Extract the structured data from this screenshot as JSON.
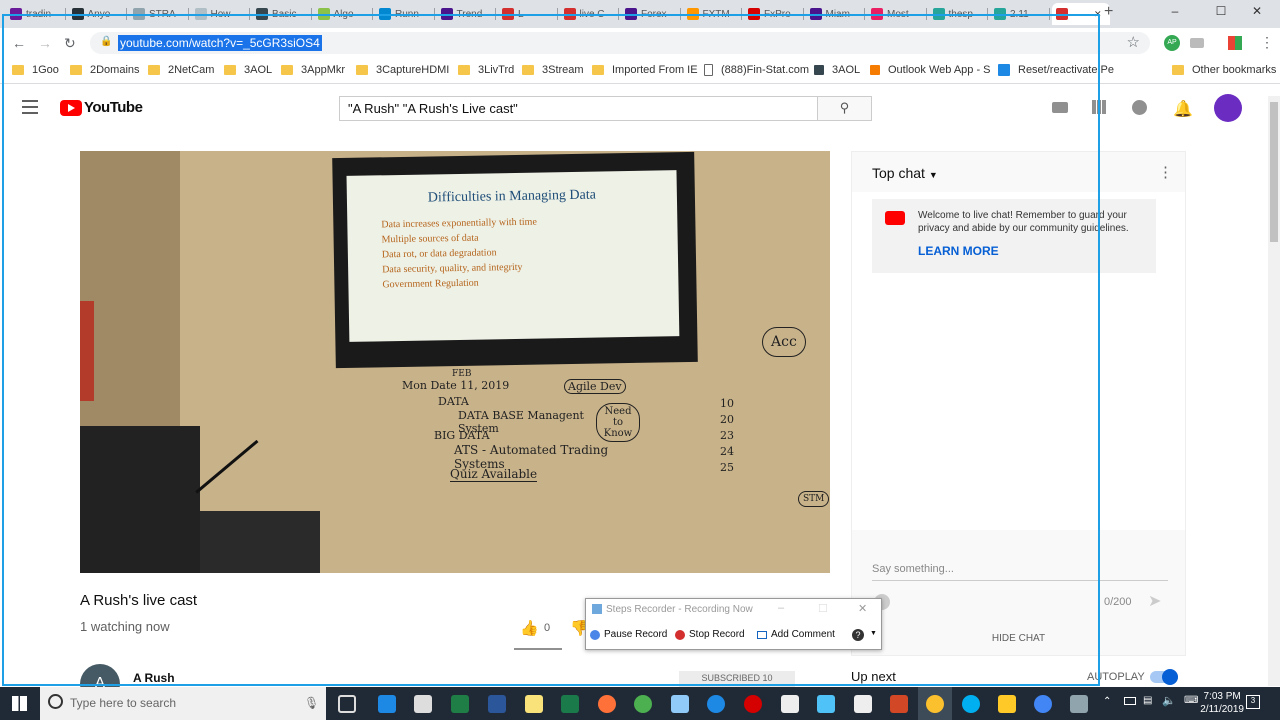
{
  "browser": {
    "tabs": [
      {
        "label": "tradin",
        "color": "#6a1b9a"
      },
      {
        "label": "Anyo",
        "color": "#263238"
      },
      {
        "label": "STRA",
        "color": "#90a4ae"
      },
      {
        "label": "How",
        "color": "#b0bec5"
      },
      {
        "label": "Basic",
        "color": "#37474f"
      },
      {
        "label": "Algo",
        "color": "#8bc34a"
      },
      {
        "label": "Runn",
        "color": "#0288d1"
      },
      {
        "label": "Trend",
        "color": "#4a148c"
      },
      {
        "label": "L",
        "color": "#d32f2f"
      },
      {
        "label": "live C",
        "color": "#d32f2f"
      },
      {
        "label": "Forex",
        "color": "#4a148c"
      },
      {
        "label": "FXTM",
        "color": "#ff9800"
      },
      {
        "label": "FxPro",
        "color": "#d50000"
      },
      {
        "label": "Miam",
        "color": "#4a148c"
      },
      {
        "label": "Most",
        "color": "#e91e63"
      },
      {
        "label": "thesp",
        "color": "#26a69a"
      },
      {
        "label": "2.11",
        "color": "#26a69a"
      },
      {
        "label": "",
        "color": "#d32f2f"
      }
    ],
    "new_tab": "+",
    "window_controls": [
      "–",
      "☐",
      "✕"
    ],
    "url": "youtube.com/watch?v=_5cGR3siOS4",
    "bookmarks": [
      "1Goo",
      "2Domains",
      "2NetCam",
      "3AOL",
      "3AppMkr",
      "3CaptureHDMI",
      "3LivTrd",
      "3Stream",
      "Imported From IE",
      "(888)Fin-Stat.com",
      "3AOL",
      "Outlook Web App - S",
      "Reset/reactivate Pe"
    ],
    "other_bookmarks": "Other bookmarks",
    "profile_badge": "AP"
  },
  "youtube": {
    "logo": "YouTube",
    "search_query": "\"A Rush\" \"A Rush's Live cast\"",
    "video": {
      "slide_title": "Difficulties in Managing Data",
      "slide_bullets": [
        "Data increases exponentially with time",
        "Multiple sources of data",
        "Data rot, or data degradation",
        "Data security, quality, and integrity",
        "Government Regulation"
      ],
      "whiteboard": [
        "FEB",
        "Mon Date 11, 2019",
        "Agile Dev",
        "DATA",
        "DATA BASE Managent System",
        "Need to Know",
        "BIG DATA",
        "ATS - Automated Trading Systems",
        "Quiz Available",
        "Acc",
        "STM",
        "10",
        "20",
        "23",
        "24",
        "25"
      ]
    },
    "title": "A Rush's live cast",
    "watching": "1 watching now",
    "likes": "0",
    "channel": "A Rush",
    "channel_initial": "A",
    "subscribe": "SUBSCRIBED  10",
    "chat": {
      "header": "Top chat",
      "welcome": "Welcome to live chat! Remember to guard your privacy and abide by our community guidelines.",
      "learn_more": "LEARN MORE",
      "placeholder": "Say something...",
      "counter": "0/200",
      "hide": "HIDE CHAT"
    },
    "up_next": "Up next",
    "autoplay": "AUTOPLAY"
  },
  "steps_recorder": {
    "title": "Steps Recorder - Recording Now",
    "pause": "Pause Record",
    "stop": "Stop Record",
    "add_comment": "Add Comment"
  },
  "taskbar": {
    "search_placeholder": "Type here to search",
    "time": "7:03 PM",
    "date": "2/11/2019",
    "notifications": "3"
  }
}
